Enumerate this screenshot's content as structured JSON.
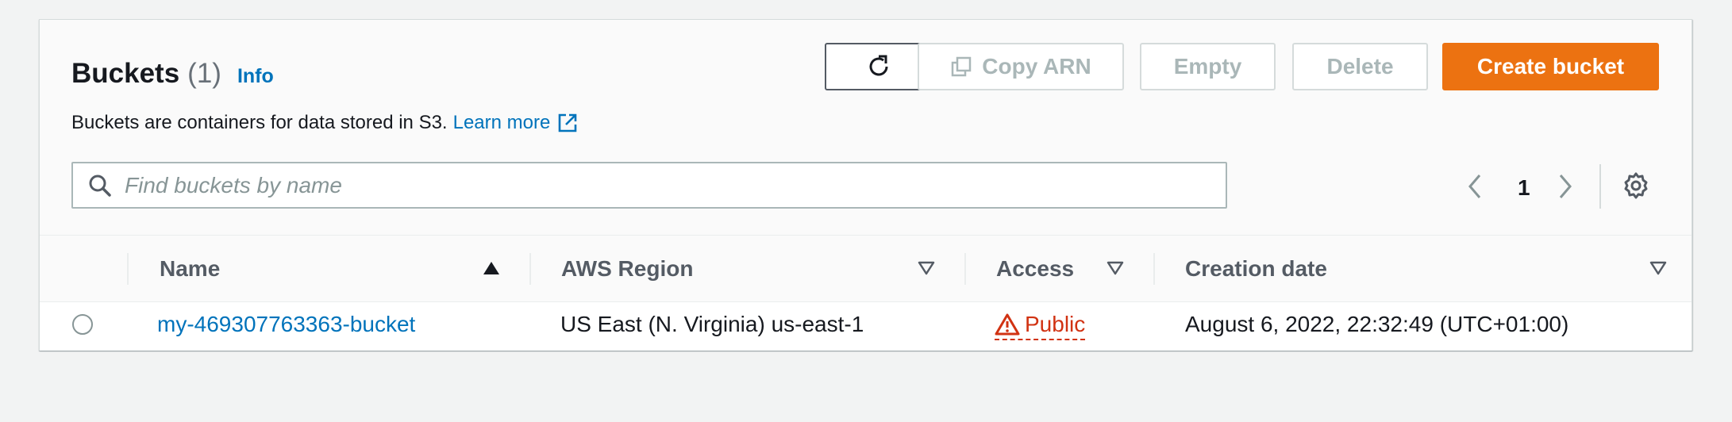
{
  "header": {
    "title": "Buckets",
    "count": "(1)",
    "info": "Info",
    "description": "Buckets are containers for data stored in S3.",
    "learn_more": "Learn more"
  },
  "toolbar": {
    "refresh_icon": "refresh-icon",
    "copy_arn": "Copy ARN",
    "empty": "Empty",
    "delete": "Delete",
    "create_bucket": "Create bucket"
  },
  "search": {
    "placeholder": "Find buckets by name",
    "value": ""
  },
  "pagination": {
    "current_page": "1"
  },
  "table": {
    "columns": [
      "Name",
      "AWS Region",
      "Access",
      "Creation date"
    ],
    "rows": [
      {
        "name": "my-469307763363-bucket",
        "region": "US East (N. Virginia) us-east-1",
        "access": "Public",
        "created": "August 6, 2022, 22:32:49 (UTC+01:00)"
      }
    ]
  },
  "colors": {
    "primary_button": "#ec7211",
    "link": "#0073bb",
    "public_warning": "#d13212",
    "background": "#f2f3f3"
  }
}
